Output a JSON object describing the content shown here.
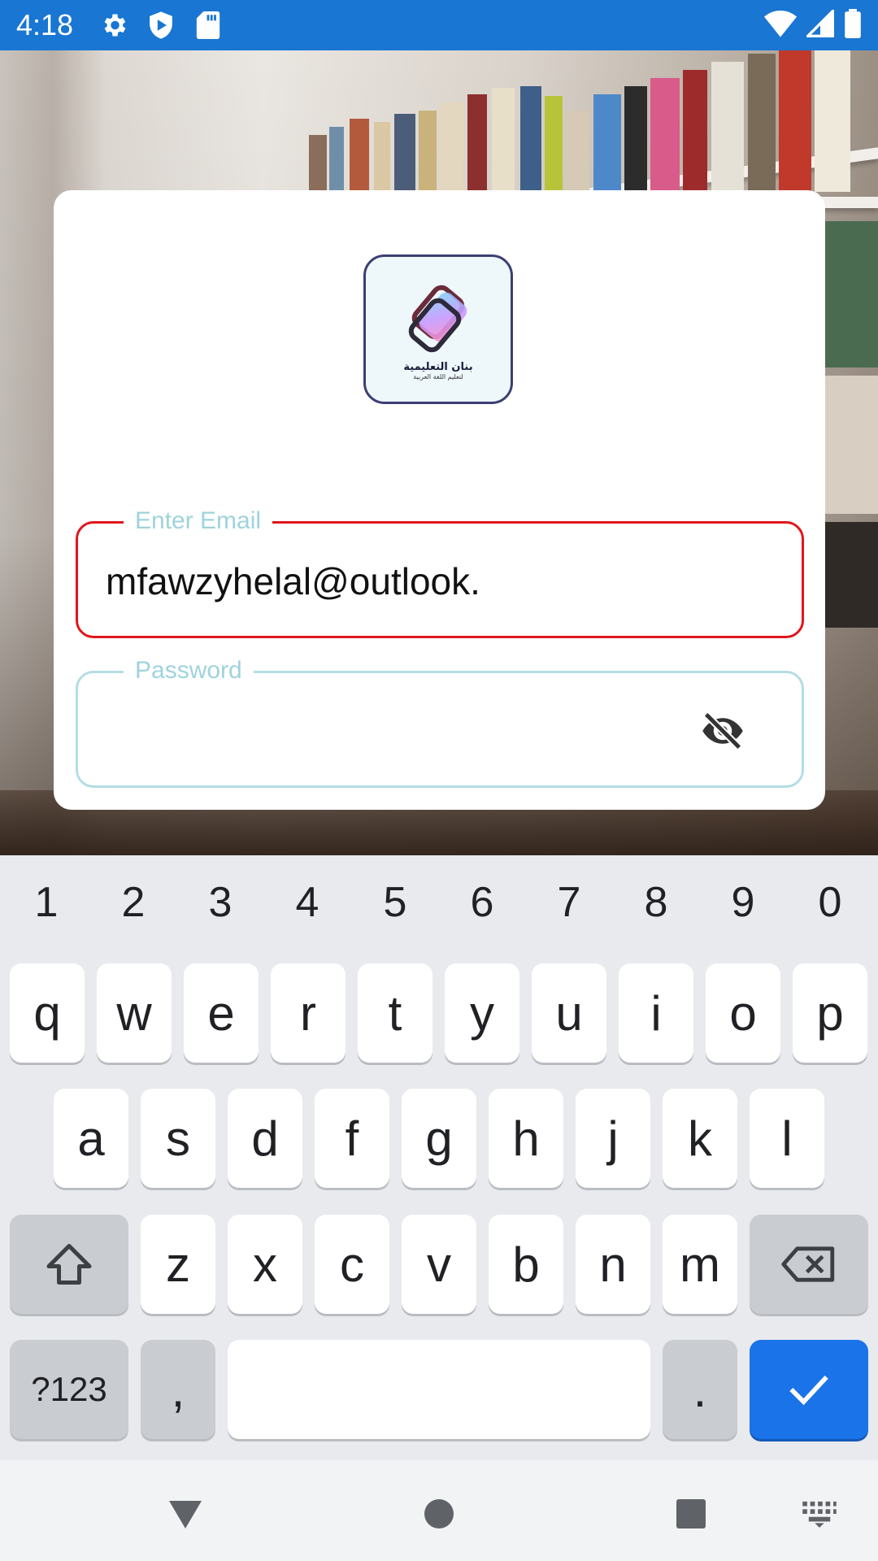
{
  "status_bar": {
    "time": "4:18",
    "icons": [
      "gear-icon",
      "shield-play-icon",
      "sd-card-icon",
      "wifi-icon",
      "signal-icon",
      "battery-icon"
    ]
  },
  "login": {
    "logo_text": "بنان التعليمية",
    "logo_subtext": "لتعليم اللغة العربية",
    "email_label": "Enter Email",
    "email_value": "mfawzyhelal@outlook.",
    "password_label": "Password",
    "password_value": "",
    "colors": {
      "error_border": "#e0161b",
      "label": "#9fd3dc",
      "password_border": "#b3dde4"
    }
  },
  "keyboard": {
    "numbers": [
      "1",
      "2",
      "3",
      "4",
      "5",
      "6",
      "7",
      "8",
      "9",
      "0"
    ],
    "row1": [
      "q",
      "w",
      "e",
      "r",
      "t",
      "y",
      "u",
      "i",
      "o",
      "p"
    ],
    "row2": [
      "a",
      "s",
      "d",
      "f",
      "g",
      "h",
      "j",
      "k",
      "l"
    ],
    "row3": [
      "z",
      "x",
      "c",
      "v",
      "b",
      "n",
      "m"
    ],
    "symbols_label": "?123",
    "comma": ",",
    "period": ".",
    "enter_color": "#1a73e8"
  },
  "nav_bar": {
    "buttons": [
      "back-triangle-icon",
      "home-circle-icon",
      "recents-square-icon",
      "keyboard-switch-icon"
    ]
  }
}
